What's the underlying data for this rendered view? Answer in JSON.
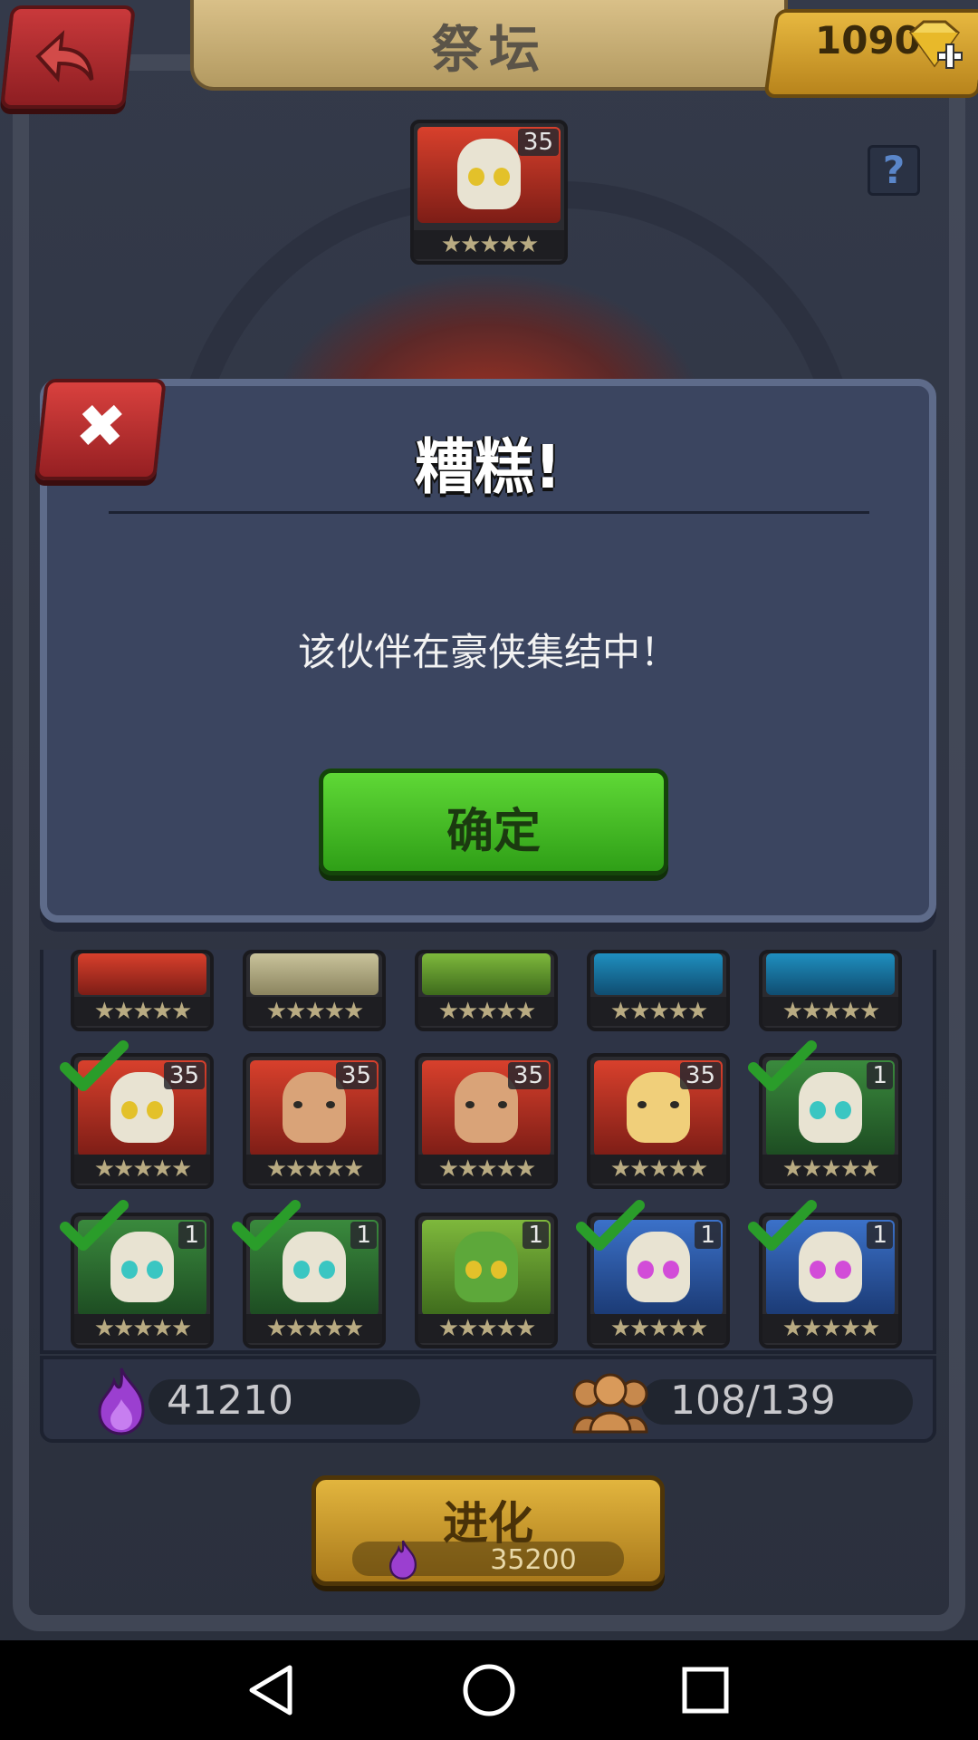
{
  "header": {
    "title": "祭坛",
    "gems": "10903"
  },
  "help": {
    "label": "?"
  },
  "altar": {
    "hero": {
      "level": "35",
      "stars": "★★★★★"
    }
  },
  "dialog": {
    "title": "糟糕!",
    "message": "该伙伴在豪侠集结中！",
    "ok_label": "确定",
    "close_label": "✖"
  },
  "heroes": {
    "row_partial": [
      {
        "stars": "★★★★★"
      },
      {
        "stars": "★★★★★"
      },
      {
        "stars": "★★★★★"
      },
      {
        "stars": "★★★★★"
      },
      {
        "stars": "★★★★★"
      }
    ],
    "row2": [
      {
        "level": "35",
        "stars": "★★★★★",
        "checked": true
      },
      {
        "level": "35",
        "stars": "★★★★★",
        "checked": false
      },
      {
        "level": "35",
        "stars": "★★★★★",
        "checked": false
      },
      {
        "level": "35",
        "stars": "★★★★★",
        "checked": false
      },
      {
        "level": "1",
        "stars": "★★★★★",
        "checked": true
      }
    ],
    "row3": [
      {
        "level": "1",
        "stars": "★★★★★",
        "checked": true
      },
      {
        "level": "1",
        "stars": "★★★★★",
        "checked": true
      },
      {
        "level": "1",
        "stars": "★★★★★",
        "checked": false
      },
      {
        "level": "1",
        "stars": "★★★★★",
        "checked": true
      },
      {
        "level": "1",
        "stars": "★★★★★",
        "checked": true
      }
    ]
  },
  "resources": {
    "essence": "41210",
    "heroes_count": "108/139"
  },
  "evolve": {
    "label": "进化",
    "cost": "35200"
  },
  "colors": {
    "accent_green": "#3fbf22",
    "accent_gold": "#d9a931",
    "accent_red": "#c8302f"
  }
}
